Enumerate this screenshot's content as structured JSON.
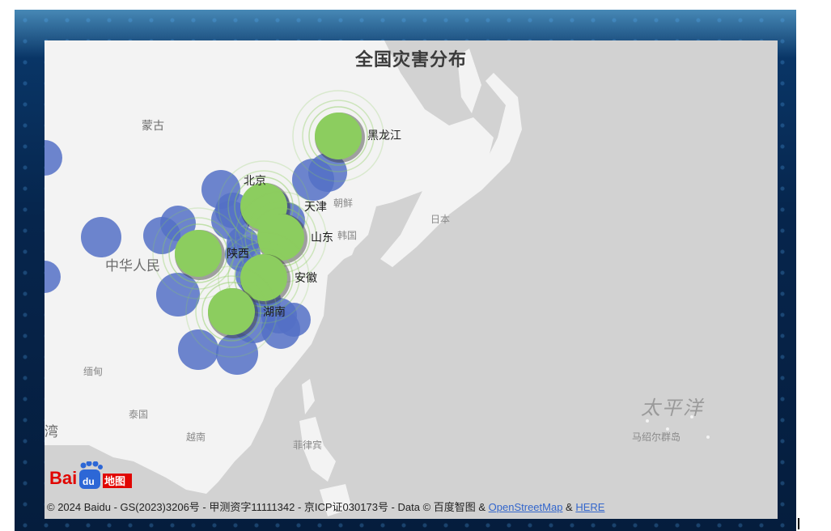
{
  "map": {
    "title": "全国灾害分布",
    "geo_labels": {
      "mongolia": "蒙古",
      "china": "中华人民",
      "north_korea": "朝鲜",
      "south_korea": "韩国",
      "japan": "日本",
      "myanmar": "缅甸",
      "thailand": "泰国",
      "vietnam": "越南",
      "philippines": "菲律宾",
      "taiwan": "湾",
      "pacific": "太平洋",
      "marshall": "马绍尔群岛"
    },
    "highlighted_regions": [
      {
        "name": "黑龙江"
      },
      {
        "name": "天津"
      },
      {
        "name": "山东"
      },
      {
        "name": "陕西"
      },
      {
        "name": "安徽"
      },
      {
        "name": "湖南"
      }
    ],
    "partial_label": "北京",
    "colors": {
      "highlight": "#8ccd5f",
      "scatter": "#5470c6",
      "water": "#d2d2d2",
      "land": "#f3f3f3"
    },
    "attribution": {
      "logo_bai": "Bai",
      "logo_du": "du",
      "logo_map": "地图",
      "text": "© 2024 Baidu - GS(2023)3206号 - 甲测资字11111342 - 京ICP证030173号 - Data © 百度智图 & ",
      "osm": "OpenStreetMap",
      "and": " & ",
      "here": "HERE"
    }
  }
}
